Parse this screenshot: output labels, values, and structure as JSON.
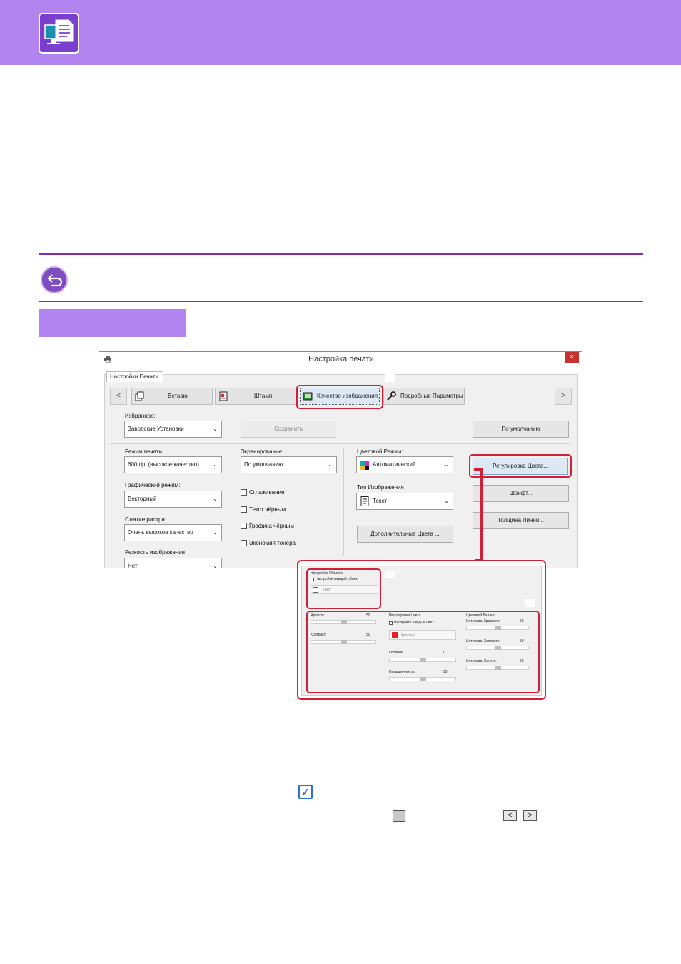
{
  "dialog": {
    "title": "Настройка печати",
    "close_glyph": "×",
    "tab": "Настройки Печати",
    "nav_prev": "<",
    "nav_next": ">",
    "categories": [
      "Вставки",
      "Штамп",
      "Качество изображения",
      "Подробные Параметры"
    ],
    "favorites": {
      "label": "Избранное:",
      "value": "Заводские Установки",
      "save": "Сохранить",
      "default": "По умолчанию"
    },
    "print_mode": {
      "label": "Режим печати:",
      "value": "600 dpi (высокое качество)"
    },
    "graphics_mode": {
      "label": "Графический режим:",
      "value": "Векторный"
    },
    "raster_compression": {
      "label": "Сжатие растра:",
      "value": "Очень высокое качество"
    },
    "sharpness": {
      "label": "Резкость изображения",
      "value": "Нет"
    },
    "screening": {
      "label": "Экранирование:",
      "value": "По умолчанию"
    },
    "checkboxes": [
      "Сглаживание",
      "Текст чёрным",
      "Графика чёрным",
      "Экономия тонера"
    ],
    "color_mode": {
      "label": "Цветовой Режим:",
      "value": "Автоматический"
    },
    "image_type": {
      "label": "Тип Изображения",
      "value": "Текст"
    },
    "extra_colors": "Дополнительные Цвета ...",
    "color_adjust": "Регулировка Цвета...",
    "font": "Шрифт...",
    "line_width": "Толщина Линии..."
  },
  "zoom": {
    "object_settings": {
      "title": "Настройка Объекта",
      "checkbox": "Настройте каждый объект",
      "select": "Текст"
    },
    "brightness": {
      "label": "Яркость:",
      "value": "50"
    },
    "contrast": {
      "label": "Контраст:",
      "value": "50"
    },
    "color_adjust": {
      "title": "Регулировка Цвета",
      "checkbox": "Настройте каждый цвет",
      "select": "Красный",
      "hue": {
        "label": "Оттенок:",
        "value": "0"
      },
      "saturation": {
        "label": "Насыщенность:",
        "value": "50"
      }
    },
    "color_balance": {
      "title": "Цветовой Баланс",
      "red": {
        "label": "Интенсив. Красного:",
        "value": "50"
      },
      "green": {
        "label": "Интенсив. Зеленого:",
        "value": "50"
      },
      "blue": {
        "label": "Интенсив. Синего:",
        "value": "50"
      }
    },
    "arrow_left": "<",
    "arrow_right": ">"
  },
  "glyphs": {
    "check": "✓",
    "left": "<",
    "right": ">"
  },
  "colors": {
    "header": "#b184f0",
    "accent": "#7f2db8",
    "highlight": "#d0203a",
    "red_swatch": "#e8202a"
  }
}
